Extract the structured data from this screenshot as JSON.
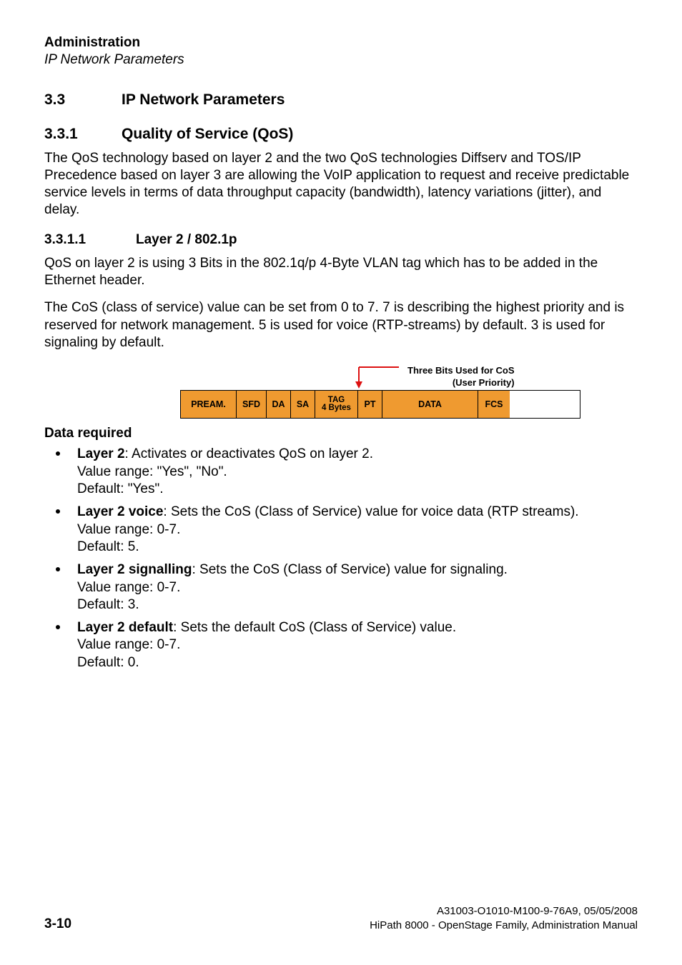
{
  "header": {
    "title_bold": "Administration",
    "title_italic": "IP Network Parameters"
  },
  "sec33": {
    "num": "3.3",
    "title": "IP Network Parameters"
  },
  "sec331": {
    "num": "3.3.1",
    "title": "Quality of Service (QoS)"
  },
  "para_qos": "The QoS technology based on layer 2 and the two QoS technologies Diffserv and TOS/IP Precedence based on layer 3 are allowing the VoIP application to request and receive predictable service levels in terms of data throughput capacity (bandwidth), latency variations (jitter), and delay.",
  "sec3311": {
    "num": "3.3.1.1",
    "title": "Layer 2 / 802.1p"
  },
  "para_l2a": "QoS on layer 2 is using 3 Bits in the 802.1q/p 4-Byte VLAN tag which has to be added in the Ethernet header.",
  "para_l2b": "The CoS (class of service) value can be set from 0 to 7. 7 is describing the highest priority and is reserved for network management. 5 is used for voice (RTP-streams) by default. 3 is used for signaling by default.",
  "diagram": {
    "cos_line1": "Three Bits Used for CoS",
    "cos_line2": "(User Priority)",
    "cells": {
      "pream": "PREAM.",
      "sfd": "SFD",
      "da": "DA",
      "sa": "SA",
      "tag1": "TAG",
      "tag2": "4 Bytes",
      "pt": "PT",
      "data": "DATA",
      "fcs": "FCS"
    }
  },
  "data_required_label": "Data required",
  "bullets": {
    "b1": {
      "lead": "Layer 2",
      "rest": ": Activates or deactivates QoS on layer 2.",
      "range": "Value range: \"Yes\", \"No\".",
      "def": "Default: \"Yes\"."
    },
    "b2": {
      "lead": "Layer 2 voice",
      "rest": ": Sets the CoS (Class of Service) value for voice data (RTP streams).",
      "range": "Value range: 0-7.",
      "def": "Default: 5."
    },
    "b3": {
      "lead": "Layer 2 signalling",
      "rest": ": Sets the CoS (Class of Service) value for signaling.",
      "range": "Value range: 0-7.",
      "def": "Default: 3."
    },
    "b4": {
      "lead": "Layer 2 default",
      "rest": ": Sets the default CoS (Class of Service) value.",
      "range": "Value range: 0-7.",
      "def": "Default: 0."
    }
  },
  "footer": {
    "page": "3-10",
    "right1": "A31003-O1010-M100-9-76A9, 05/05/2008",
    "right2": "HiPath 8000 - OpenStage Family, Administration Manual"
  }
}
